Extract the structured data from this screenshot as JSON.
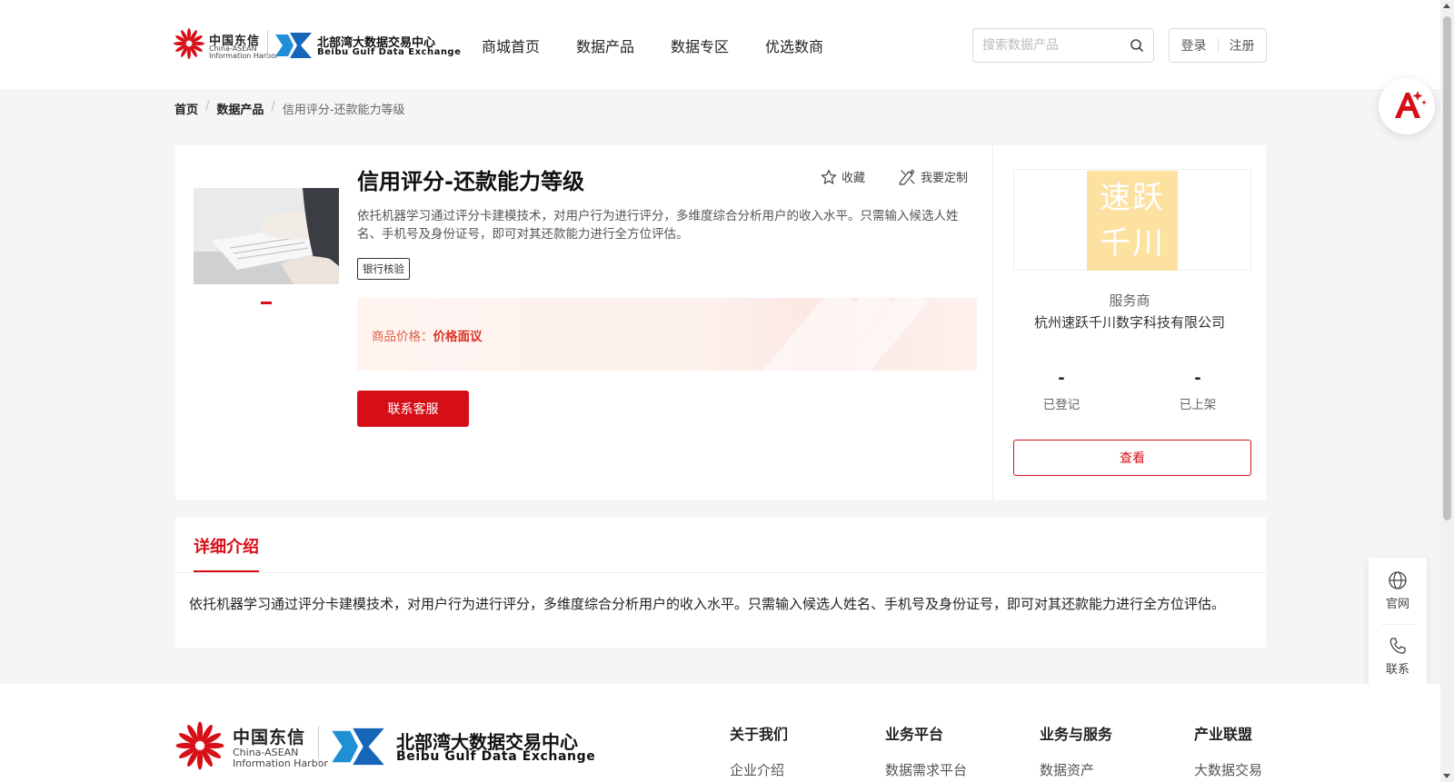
{
  "header": {
    "logo_ct": {
      "cn": "中国东信",
      "en_line1": "China-ASEAN",
      "en_line2": "Information Harbor"
    },
    "logo_bg": {
      "cn": "北部湾大数据交易中心",
      "en": "Beibu Gulf Data Exchange"
    },
    "nav": [
      {
        "label": "商城首页"
      },
      {
        "label": "数据产品"
      },
      {
        "label": "数据专区"
      },
      {
        "label": "优选数商"
      }
    ],
    "search": {
      "placeholder": "搜索数据产品",
      "value": "",
      "icon": "search-icon"
    },
    "login_label": "登录",
    "register_label": "注册",
    "ai_assistant_icon": "ai-assistant-icon"
  },
  "breadcrumb": {
    "home": "首页",
    "products": "数据产品",
    "current": "信用评分-还款能力等级",
    "separator": "/"
  },
  "product": {
    "title": "信用评分-还款能力等级",
    "favorite_label": "收藏",
    "customize_label": "我要定制",
    "description": "依托机器学习通过评分卡建模技术，对用户行为进行评分，多维度综合分析用户的收入水平。只需输入候选人姓名、手机号及身份证号，即可对其还款能力进行全方位评估。",
    "tag": "银行核验",
    "price_label": "商品价格：",
    "price_value": "价格面议",
    "contact_button": "联系客服"
  },
  "provider": {
    "logo_line1": "速跃",
    "logo_line2": "千川",
    "role": "服务商",
    "name": "杭州速跃千川数字科技有限公司",
    "stats": [
      {
        "value": "-",
        "label": "已登记"
      },
      {
        "value": "-",
        "label": "已上架"
      }
    ],
    "view_button": "查看"
  },
  "detail": {
    "tab_label": "详细介绍",
    "text": "依托机器学习通过评分卡建模技术，对用户行为进行评分，多维度综合分析用户的收入水平。只需输入候选人姓名、手机号及身份证号，即可对其还款能力进行全方位评估。"
  },
  "side_float": {
    "items": [
      {
        "label": "官网",
        "icon": "globe-icon"
      },
      {
        "label": "联系",
        "icon": "phone-icon"
      }
    ]
  },
  "footer": {
    "columns": [
      {
        "heading": "关于我们",
        "first_link": "企业介绍"
      },
      {
        "heading": "业务平台",
        "first_link": "数据需求平台"
      },
      {
        "heading": "业务与服务",
        "first_link": "数据资产"
      },
      {
        "heading": "产业联盟",
        "first_link": "大数据交易"
      }
    ]
  },
  "colors": {
    "brand_red": "#d60e17",
    "price_text": "#d9362b",
    "provider_logo_bg": "#fde1a0",
    "page_bg": "#f4f5f7"
  }
}
